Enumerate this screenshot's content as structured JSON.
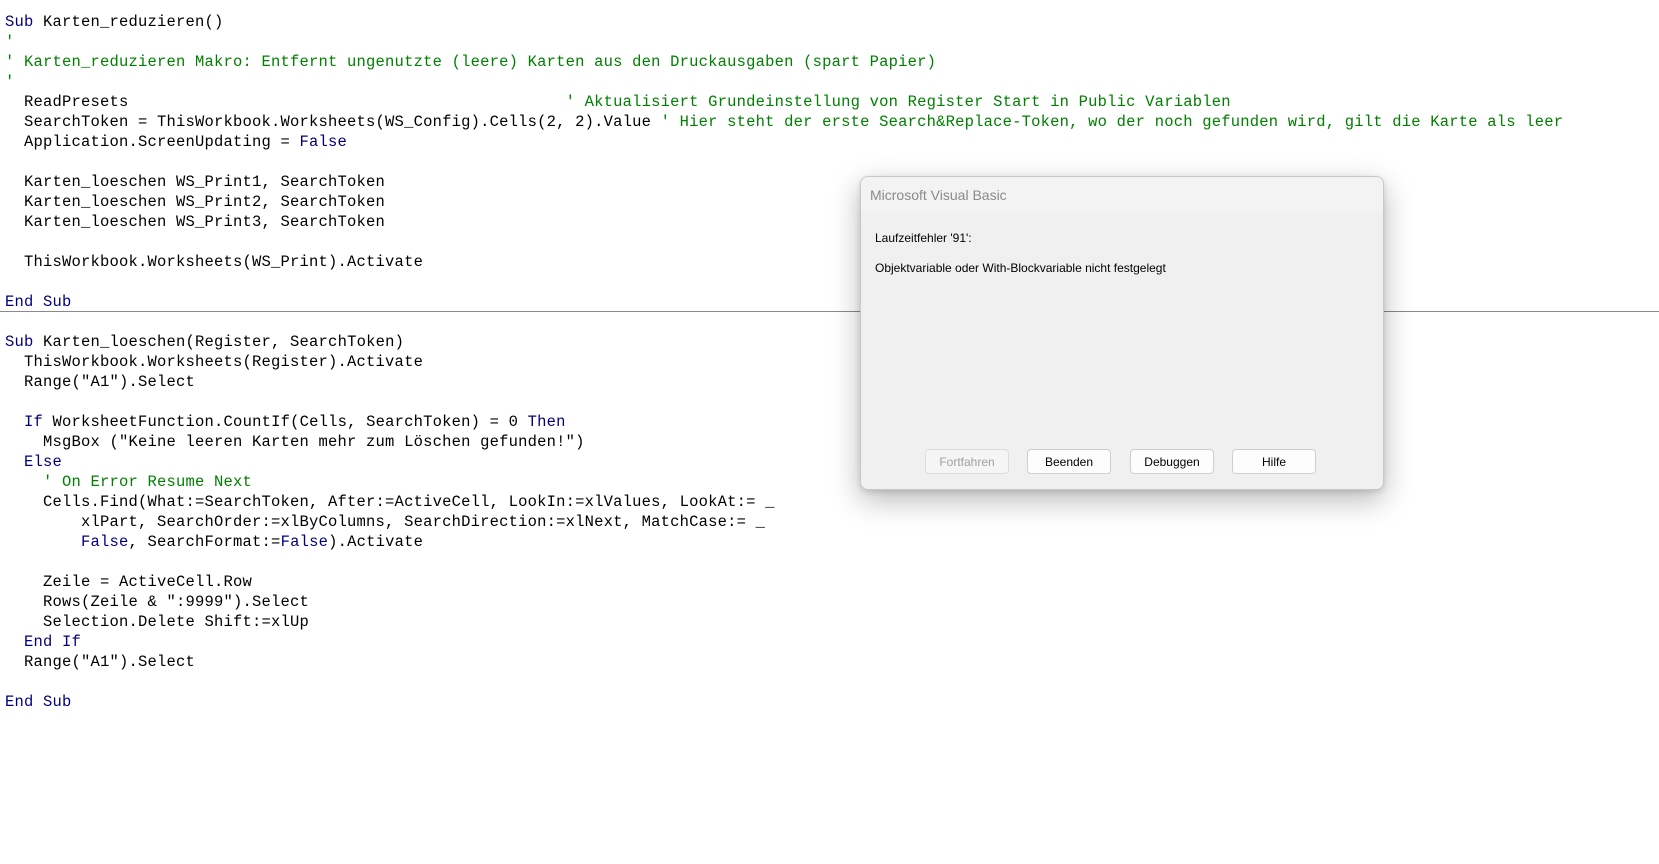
{
  "editor": {
    "lines": [
      [
        {
          "t": "Sub",
          "c": "kw"
        },
        {
          "t": " Karten_reduzieren()"
        }
      ],
      [
        {
          "t": "'",
          "c": "cm"
        }
      ],
      [
        {
          "t": "' Karten_reduzieren Makro: Entfernt ungenutzte (leere) Karten aus den Druckausgaben (spart Papier)",
          "c": "cm"
        }
      ],
      [
        {
          "t": "'",
          "c": "cm"
        }
      ],
      [
        {
          "t": "  ReadPresets                                              "
        },
        {
          "t": "' Aktualisiert Grundeinstellung von Register Start in Public Variablen",
          "c": "cm"
        }
      ],
      [
        {
          "t": "  SearchToken = ThisWorkbook.Worksheets(WS_Config).Cells(2, 2).Value "
        },
        {
          "t": "' Hier steht der erste Search&Replace-Token, wo der noch gefunden wird, gilt die Karte als leer",
          "c": "cm"
        }
      ],
      [
        {
          "t": "  Application.ScreenUpdating = "
        },
        {
          "t": "False",
          "c": "kw"
        }
      ],
      [],
      [
        {
          "t": "  Karten_loeschen WS_Print1, SearchToken"
        }
      ],
      [
        {
          "t": "  Karten_loeschen WS_Print2, SearchToken"
        }
      ],
      [
        {
          "t": "  Karten_loeschen WS_Print3, SearchToken"
        }
      ],
      [],
      [
        {
          "t": "  ThisWorkbook.Worksheets(WS_Print).Activate"
        }
      ],
      [],
      [
        {
          "t": "End Sub",
          "c": "kw"
        }
      ],
      [],
      [
        {
          "t": "Sub",
          "c": "kw"
        },
        {
          "t": " Karten_loeschen(Register, SearchToken)"
        }
      ],
      [
        {
          "t": "  ThisWorkbook.Worksheets(Register).Activate"
        }
      ],
      [
        {
          "t": "  Range(\"A1\").Select"
        }
      ],
      [],
      [
        {
          "t": "  "
        },
        {
          "t": "If",
          "c": "kw"
        },
        {
          "t": " WorksheetFunction.CountIf(Cells, SearchToken) = 0 "
        },
        {
          "t": "Then",
          "c": "kw"
        }
      ],
      [
        {
          "t": "    MsgBox (\"Keine leeren Karten mehr zum Löschen gefunden!\")"
        }
      ],
      [
        {
          "t": "  "
        },
        {
          "t": "Else",
          "c": "kw"
        }
      ],
      [
        {
          "t": "    "
        },
        {
          "t": "' On Error Resume Next",
          "c": "cm"
        }
      ],
      [
        {
          "t": "    Cells.Find(What:=SearchToken, After:=ActiveCell, LookIn:=xlValues, LookAt:= _"
        }
      ],
      [
        {
          "t": "        xlPart, SearchOrder:=xlByColumns, SearchDirection:=xlNext, MatchCase:= _"
        }
      ],
      [
        {
          "t": "        "
        },
        {
          "t": "False",
          "c": "kw"
        },
        {
          "t": ", SearchFormat:="
        },
        {
          "t": "False",
          "c": "kw"
        },
        {
          "t": ").Activate"
        }
      ],
      [],
      [
        {
          "t": "    Zeile = ActiveCell.Row"
        }
      ],
      [
        {
          "t": "    Rows(Zeile & \":9999\").Select"
        }
      ],
      [
        {
          "t": "    Selection.Delete Shift:=xlUp"
        }
      ],
      [
        {
          "t": "  "
        },
        {
          "t": "End If",
          "c": "kw"
        }
      ],
      [
        {
          "t": "  Range(\"A1\").Select"
        }
      ],
      [],
      [
        {
          "t": "End Sub",
          "c": "kw"
        }
      ]
    ]
  },
  "dialog": {
    "title": "Microsoft Visual Basic",
    "error_heading": "Laufzeitfehler '91':",
    "error_message": "Objektvariable oder With-Blockvariable nicht festgelegt",
    "buttons": {
      "continue": "Fortfahren",
      "end": "Beenden",
      "debug": "Debuggen",
      "help": "Hilfe"
    }
  }
}
